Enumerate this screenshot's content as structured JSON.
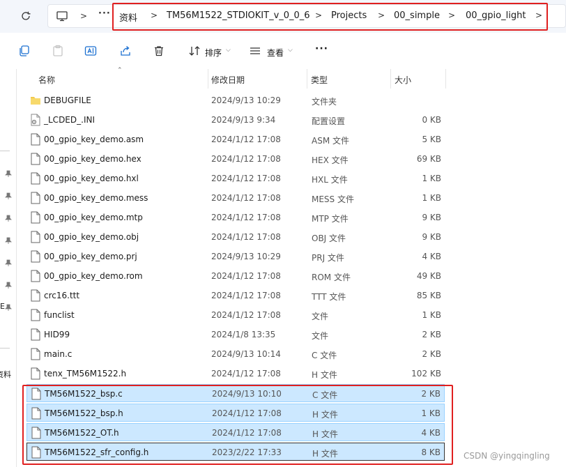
{
  "breadcrumb": {
    "more": "···",
    "items": [
      "资料",
      "TM56M1522_STDIOKIT_v_0_0_6",
      "Projects",
      "00_simple",
      "00_gpio_light"
    ]
  },
  "toolbar": {
    "sort_label": "排序",
    "view_label": "查看",
    "more_label": "···"
  },
  "left_pane": {
    "label_e": "E",
    "label_zl": "资料"
  },
  "columns": {
    "name": "名称",
    "date": "修改日期",
    "type": "类型",
    "size": "大小"
  },
  "files": [
    {
      "name": "DEBUGFILE",
      "date": "2024/9/13 10:29",
      "type": "文件夹",
      "size": "",
      "icon": "folder-icon"
    },
    {
      "name": "_LCDED_.INI",
      "date": "2024/9/13 9:34",
      "type": "配置设置",
      "size": "0 KB",
      "icon": "settings-file-icon"
    },
    {
      "name": "00_gpio_key_demo.asm",
      "date": "2024/1/12 17:08",
      "type": "ASM 文件",
      "size": "5 KB",
      "icon": "file-icon"
    },
    {
      "name": "00_gpio_key_demo.hex",
      "date": "2024/1/12 17:08",
      "type": "HEX 文件",
      "size": "69 KB",
      "icon": "file-icon"
    },
    {
      "name": "00_gpio_key_demo.hxl",
      "date": "2024/1/12 17:08",
      "type": "HXL 文件",
      "size": "1 KB",
      "icon": "file-icon"
    },
    {
      "name": "00_gpio_key_demo.mess",
      "date": "2024/1/12 17:08",
      "type": "MESS 文件",
      "size": "1 KB",
      "icon": "file-icon"
    },
    {
      "name": "00_gpio_key_demo.mtp",
      "date": "2024/1/12 17:08",
      "type": "MTP 文件",
      "size": "9 KB",
      "icon": "file-icon"
    },
    {
      "name": "00_gpio_key_demo.obj",
      "date": "2024/1/12 17:08",
      "type": "OBJ 文件",
      "size": "9 KB",
      "icon": "file-icon"
    },
    {
      "name": "00_gpio_key_demo.prj",
      "date": "2024/9/13 10:29",
      "type": "PRJ 文件",
      "size": "4 KB",
      "icon": "file-icon"
    },
    {
      "name": "00_gpio_key_demo.rom",
      "date": "2024/1/12 17:08",
      "type": "ROM 文件",
      "size": "49 KB",
      "icon": "file-icon"
    },
    {
      "name": "crc16.ttt",
      "date": "2024/1/12 17:08",
      "type": "TTT 文件",
      "size": "85 KB",
      "icon": "file-icon"
    },
    {
      "name": "funclist",
      "date": "2024/1/12 17:08",
      "type": "文件",
      "size": "1 KB",
      "icon": "file-icon"
    },
    {
      "name": "HID99",
      "date": "2024/1/8 13:35",
      "type": "文件",
      "size": "2 KB",
      "icon": "file-icon"
    },
    {
      "name": "main.c",
      "date": "2024/9/13 10:14",
      "type": "C 文件",
      "size": "2 KB",
      "icon": "file-icon"
    },
    {
      "name": "tenx_TM56M1522.h",
      "date": "2024/1/12 17:08",
      "type": "H 文件",
      "size": "102 KB",
      "icon": "file-icon"
    },
    {
      "name": "TM56M1522_bsp.c",
      "date": "2024/9/13 10:10",
      "type": "C 文件",
      "size": "2 KB",
      "icon": "file-icon",
      "selected": true
    },
    {
      "name": "TM56M1522_bsp.h",
      "date": "2024/1/12 17:08",
      "type": "H 文件",
      "size": "1 KB",
      "icon": "file-icon",
      "selected": true
    },
    {
      "name": "TM56M1522_OT.h",
      "date": "2024/1/12 17:08",
      "type": "H 文件",
      "size": "4 KB",
      "icon": "file-icon",
      "selected": true
    },
    {
      "name": "TM56M1522_sfr_config.h",
      "date": "2023/2/22 17:33",
      "type": "H 文件",
      "size": "8 KB",
      "icon": "file-icon",
      "selected": true,
      "focused": true
    }
  ],
  "watermark": "CSDN @yingqingling",
  "colors": {
    "selection": "#cce8ff",
    "selection_border": "#99d1ff",
    "highlight_red": "#e02020",
    "folder": "#f2c94c"
  }
}
